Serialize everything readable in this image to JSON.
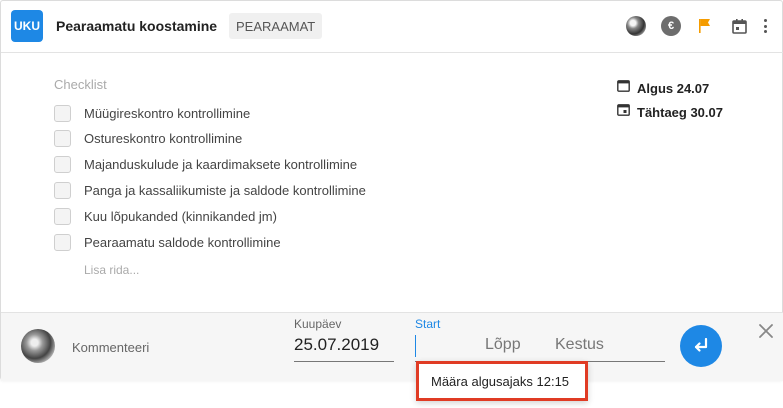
{
  "header": {
    "badge": "UKU",
    "title": "Pearaamatu koostamine",
    "tag": "PEARAAMAT",
    "icons": [
      "user-avatar-icon",
      "euro-icon",
      "flag-icon",
      "calendar-icon",
      "more-vertical-icon"
    ],
    "flag_color": "#f59c00"
  },
  "checklist": {
    "title": "Checklist",
    "items": [
      "Müügireskontro kontrollimine",
      "Ostureskontro kontrollimine",
      "Majanduskulude ja kaardimaksete kontrollimine",
      "Panga ja kassaliikumiste ja saldode kontrollimine",
      "Kuu lõpukanded (kinnikanded jm)",
      "Pearaamatu saldode kontrollimine"
    ],
    "add_row": "Lisa rida..."
  },
  "dates": {
    "start": "Algus 24.07",
    "due": "Tähtaeg 30.07"
  },
  "footer": {
    "comment": "Kommenteeri",
    "date_label": "Kuupäev",
    "date_value": "25.07.2019",
    "start_label": "Start",
    "end_placeholder": "Lõpp",
    "duration_placeholder": "Kestus"
  },
  "suggestion": {
    "text": "Määra algusajaks 12:15"
  },
  "colors": {
    "accent": "#1e88e5",
    "highlight": "#e03b24"
  }
}
